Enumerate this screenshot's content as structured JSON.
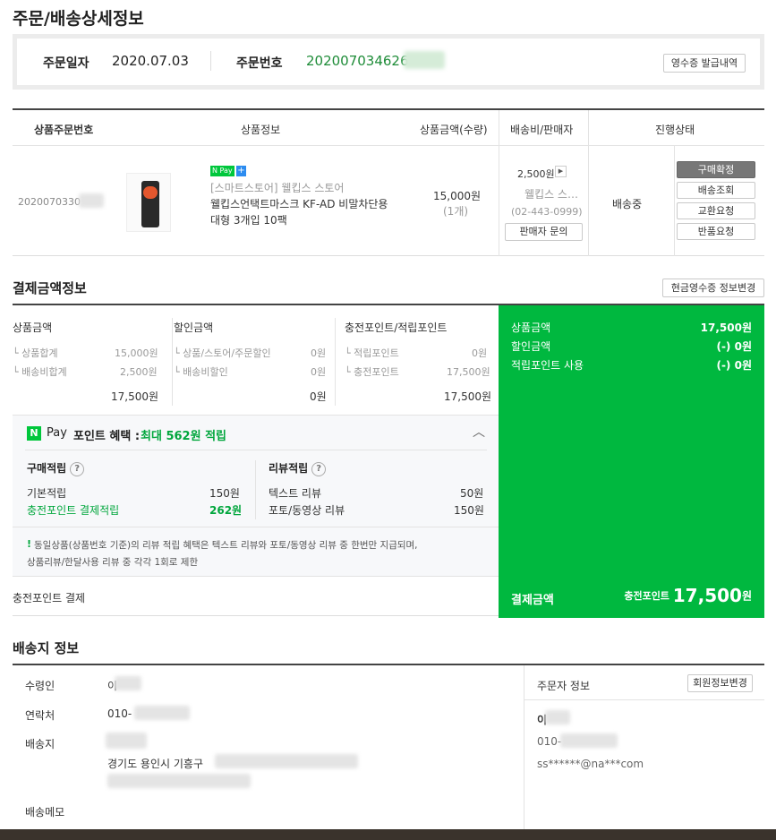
{
  "page": {
    "title": "주문/배송상세정보"
  },
  "order": {
    "date_label": "주문일자",
    "date": "2020.07.03",
    "number_label": "주문번호",
    "number": "20200703462",
    "number_tail": "6",
    "receipt_button": "영수증 발급내역"
  },
  "table": {
    "headers": [
      "상품주문번호",
      "상품정보",
      "상품금액(수량)",
      "배송비/판매자",
      "진행상태"
    ],
    "row": {
      "product_order_no": "2020070330",
      "pay_badge": "N Pay",
      "store": "[스마트스토어] 웰킵스 스토어",
      "product_name_line1": "웰킵스언택트마스크 KF-AD 비말차단용",
      "product_name_line2": "대형 3개입 10팩",
      "price": "15,000원",
      "qty": "(1개)",
      "shipping_fee": "2,500원",
      "seller": "웰킵스 스…",
      "seller_phone": "(02-443-0999)",
      "seller_inquiry": "판매자 문의",
      "status": "배송중",
      "actions": [
        "구매확정",
        "배송조회",
        "교환요청",
        "반품요청"
      ]
    }
  },
  "payment": {
    "title": "결제금액정보",
    "cash_receipt_button": "현금영수증 정보변경",
    "col1": {
      "title": "상품금액",
      "items": [
        {
          "label": "└ 상품합계",
          "value": "15,000원"
        },
        {
          "label": "└ 배송비합계",
          "value": "2,500원"
        }
      ],
      "total": "17,500원"
    },
    "col2": {
      "title": "할인금액",
      "items": [
        {
          "label": "└ 상품/스토어/주문할인",
          "value": "0원"
        },
        {
          "label": "└ 배송비할인",
          "value": "0원"
        }
      ],
      "total": "0원"
    },
    "col3": {
      "title": "충전포인트/적립포인트",
      "items": [
        {
          "label": "└ 적립포인트",
          "value": "0원"
        },
        {
          "label": "└ 충전포인트",
          "value": "17,500원"
        }
      ],
      "total": "17,500원"
    },
    "npay": {
      "logo": "N",
      "pay": "Pay",
      "benefit_label": "포인트 혜택 :",
      "benefit_value": "최대 562원 적립",
      "purchase_title": "구매적립",
      "purchase_items": [
        {
          "label": "기본적립",
          "value": "150원"
        },
        {
          "label": "충전포인트 결제적립",
          "value": "262원"
        }
      ],
      "review_title": "리뷰적립",
      "review_items": [
        {
          "label": "텍스트 리뷰",
          "value": "50원"
        },
        {
          "label": "포토/동영상 리뷰",
          "value": "150원"
        }
      ],
      "notice_mark": "!",
      "notice_line1": "동일상품(상품번호 기준)의 리뷰 적립 혜택은 텍스트 리뷰와 포토/동영상 리뷰 중 한번만 지급되며,",
      "notice_line2": "상품리뷰/한달사용 리뷰 중 각각 1회로 제한"
    },
    "method": "충전포인트 결제",
    "summary": {
      "rows": [
        {
          "label": "상품금액",
          "value": "17,500원"
        },
        {
          "label": "할인금액",
          "value": "(-) 0원"
        },
        {
          "label": "적립포인트 사용",
          "value": "(-) 0원"
        }
      ],
      "final_label": "결제금액",
      "final_method": "충전포인트",
      "final_amount": "17,500",
      "final_unit": "원"
    }
  },
  "shipping": {
    "title": "배송지 정보",
    "recipient_label": "수령인",
    "recipient": "이",
    "phone_label": "연락처",
    "phone": "010-",
    "address_label": "배송지",
    "address": "경기도 용인시 기흥구",
    "memo_label": "배송메모",
    "orderer_title": "주문자 정보",
    "member_edit_button": "회원정보변경",
    "orderer_name": "이",
    "orderer_phone": "010-",
    "orderer_email": "ss******@na***com"
  },
  "colors": {
    "accent": "#00b83f",
    "order_no": "#1e8c38"
  }
}
